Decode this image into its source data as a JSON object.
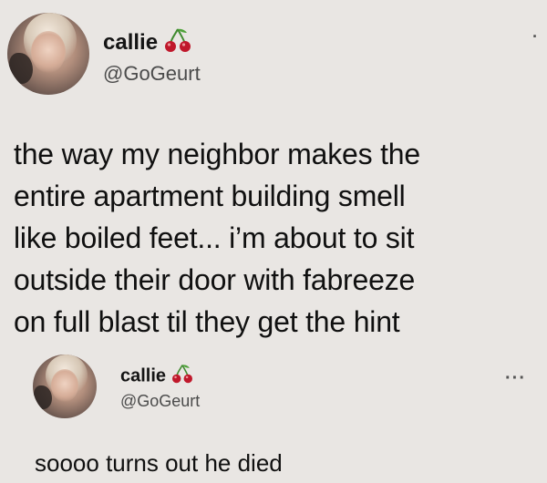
{
  "tweets": [
    {
      "display_name": "callie",
      "name_emoji_icon": "cherries-icon",
      "handle": "@GoGeurt",
      "more_icon": "more-dot-icon",
      "text_lines": [
        "the way my neighbor makes the",
        "entire apartment building smell",
        "like boiled feet... i’m about to sit",
        "outside their door with fabreeze",
        "on full blast til they get the hint"
      ]
    },
    {
      "display_name": "callie",
      "name_emoji_icon": "cherries-icon",
      "handle": "@GoGeurt",
      "more_icon": "more-dots-icon",
      "more_label": "···",
      "text": "soooo turns out he died"
    }
  ],
  "colors": {
    "background": "#e9e6e3",
    "text": "#111111",
    "handle": "#4b4b4b",
    "cherry_red": "#c0182b",
    "stem_green": "#3f8a2f"
  }
}
